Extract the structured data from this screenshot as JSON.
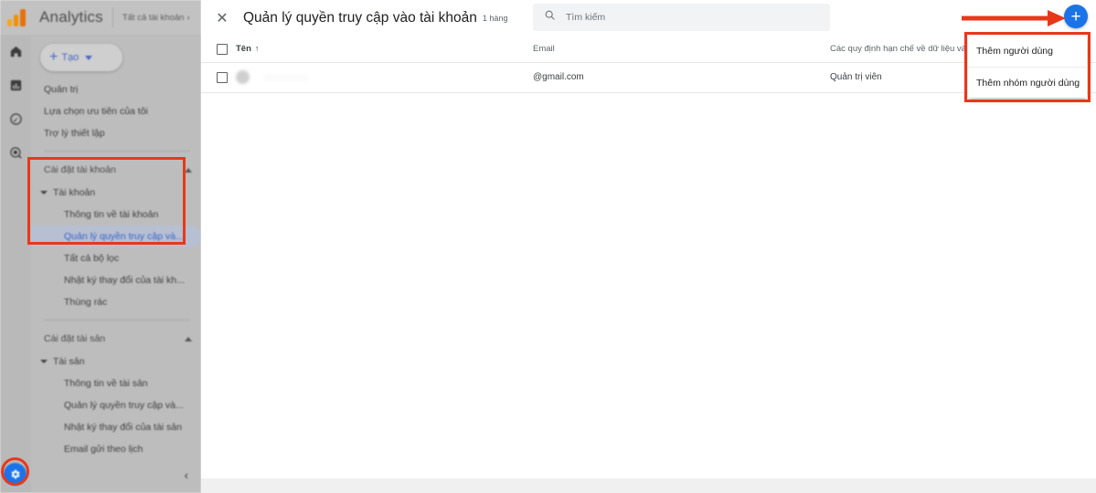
{
  "app": {
    "brand": "Analytics",
    "breadcrumb": "Tất cả tài khoản",
    "breadcrumb_chevron": "›"
  },
  "rail": {
    "icons": [
      {
        "name": "home-icon",
        "label": "Trang chủ"
      },
      {
        "name": "reports-bar-chart-icon",
        "label": "Báo cáo"
      },
      {
        "name": "explore-compass-icon",
        "label": "Khám phá"
      },
      {
        "name": "advertising-target-icon",
        "label": "Quảng cáo"
      }
    ]
  },
  "sidebar": {
    "create_button": {
      "label": "Tạo",
      "plus": "+"
    },
    "items": [
      {
        "label": "Quản trị",
        "level": 0,
        "type": "item"
      },
      {
        "label": "Lựa chọn ưu tiên của tôi",
        "level": 0,
        "type": "item"
      },
      {
        "label": "Trợ lý thiết lập",
        "level": 0,
        "type": "item"
      },
      {
        "label": "Cài đặt tài khoản",
        "level": 0,
        "type": "group"
      },
      {
        "label": "Tài khoản",
        "level": 1,
        "type": "expandable"
      },
      {
        "label": "Thông tin về tài khoản",
        "level": 2,
        "type": "item"
      },
      {
        "label": "Quản lý quyền truy cập và...",
        "level": 2,
        "type": "item",
        "selected": true
      },
      {
        "label": "Tất cả bộ lọc",
        "level": 2,
        "type": "item"
      },
      {
        "label": "Nhật ký thay đổi của tài kh...",
        "level": 2,
        "type": "item"
      },
      {
        "label": "Thùng rác",
        "level": 2,
        "type": "item"
      },
      {
        "label": "Cài đặt tài sản",
        "level": 0,
        "type": "group"
      },
      {
        "label": "Tài sản",
        "level": 1,
        "type": "expandable"
      },
      {
        "label": "Thông tin về tài sản",
        "level": 2,
        "type": "item"
      },
      {
        "label": "Quản lý quyền truy cập và...",
        "level": 2,
        "type": "item"
      },
      {
        "label": "Nhật ký thay đổi của tài sản",
        "level": 2,
        "type": "item"
      },
      {
        "label": "Email gửi theo lịch",
        "level": 2,
        "type": "item"
      }
    ],
    "collapse_chevron": "‹",
    "gear_label": "Cài đặt"
  },
  "main": {
    "close_label": "✕",
    "title": "Quản lý quyền truy cập vào tài khoản",
    "row_count": "1 hàng",
    "search": {
      "placeholder": "Tìm kiếm",
      "value": ""
    },
    "table": {
      "columns": [
        {
          "key": "select",
          "label": ""
        },
        {
          "key": "name",
          "label": "Tên",
          "sort": "↑"
        },
        {
          "key": "email",
          "label": "Email"
        },
        {
          "key": "restrictions",
          "label": "Các quy định hạn chế về dữ liệu và"
        }
      ],
      "rows": [
        {
          "name": "",
          "email": "@gmail.com",
          "restrictions": "Quản trị viên"
        }
      ]
    }
  },
  "fab": {
    "name": "add-fab",
    "label": "+"
  },
  "menu": {
    "items": [
      {
        "label": "Thêm người dùng"
      },
      {
        "label": "Thêm nhóm người dùng"
      }
    ]
  },
  "annotations": {
    "accent_color": "#e8381a",
    "arrow": "→",
    "boxes": [
      "sidebar-highlight",
      "menu-highlight"
    ],
    "circles": [
      "gear-highlight"
    ]
  },
  "colors": {
    "brand_blue": "#1a73e8",
    "link_blue": "#3b63c4",
    "annotation_red": "#e8381a",
    "logo_orange": "#e8710a"
  }
}
